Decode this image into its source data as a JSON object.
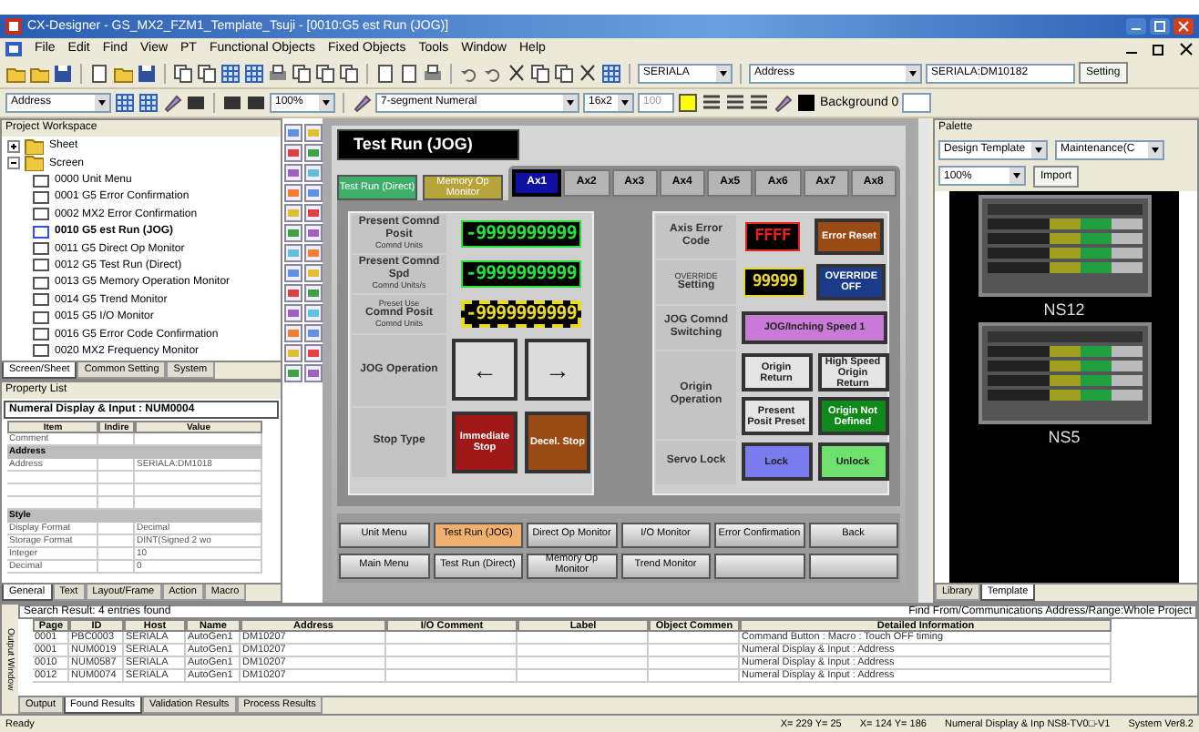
{
  "window": {
    "title": "CX-Designer - GS_MX2_FZM1_Template_Tsuji - [0010:G5 est Run (JOG)]"
  },
  "menu": [
    "File",
    "Edit",
    "Find",
    "View",
    "PT",
    "Functional Objects",
    "Fixed Objects",
    "Tools",
    "Window",
    "Help"
  ],
  "toolbar": {
    "host": "SERIALA",
    "address_mode": "Address",
    "address": "SERIALA:DM10182",
    "setting_button": "Setting"
  },
  "toolbar2": {
    "address_mode": "Address",
    "zoom": "100%",
    "object_type": "7-segment Numeral",
    "font_size": "16x2",
    "size": "100",
    "background": "Background 0"
  },
  "workspace": {
    "title": "Project Workspace",
    "tree": [
      {
        "label": "Sheet",
        "expanded": false
      },
      {
        "label": "Screen",
        "expanded": true,
        "children": [
          {
            "label": "0000 Unit Menu",
            "selected": false
          },
          {
            "label": "0001 G5 Error Confirmation",
            "selected": false
          },
          {
            "label": "0002 MX2 Error Confirmation",
            "selected": false
          },
          {
            "label": "0010 G5 est Run (JOG)",
            "selected": true
          },
          {
            "label": "0011 G5 Direct Op Monitor",
            "selected": false
          },
          {
            "label": "0012 G5 Test Run (Direct)",
            "selected": false
          },
          {
            "label": "0013 G5 Memory Operation Monitor",
            "selected": false
          },
          {
            "label": "0014 G5 Trend Monitor",
            "selected": false
          },
          {
            "label": "0015 G5 I/O Monitor",
            "selected": false
          },
          {
            "label": "0016 G5 Error Code Confirmation",
            "selected": false
          },
          {
            "label": "0020 MX2 Frequency Monitor",
            "selected": false
          }
        ]
      }
    ],
    "tabs": [
      {
        "label": "Screen/Sheet",
        "selected": true
      },
      {
        "label": "Common Setting",
        "selected": false
      },
      {
        "label": "System",
        "selected": false
      }
    ]
  },
  "property_list": {
    "title": "Property List",
    "object": "Numeral Display & Input : NUM0004",
    "columns": [
      "Item",
      "Indire",
      "Value"
    ],
    "rows": [
      {
        "kind": "row",
        "item": "Comment",
        "value": ""
      },
      {
        "kind": "section",
        "item": "Address",
        "value": ""
      },
      {
        "kind": "row",
        "item": "Address",
        "value": "SERIALA:DM1018"
      },
      {
        "kind": "row",
        "item": "",
        "value": ""
      },
      {
        "kind": "row",
        "item": "",
        "value": ""
      },
      {
        "kind": "row",
        "item": "",
        "value": ""
      },
      {
        "kind": "section",
        "item": "Style",
        "value": ""
      },
      {
        "kind": "row",
        "item": "Display Format",
        "value": "Decimal"
      },
      {
        "kind": "row",
        "item": "Storage Format",
        "value": "DINT(Signed 2 wo"
      },
      {
        "kind": "row",
        "item": "Integer",
        "value": "10"
      },
      {
        "kind": "row",
        "item": "Decimal",
        "value": "0"
      }
    ],
    "tabs": [
      {
        "label": "General",
        "selected": true
      },
      {
        "label": "Text",
        "selected": false
      },
      {
        "label": "Layout/Frame",
        "selected": false
      },
      {
        "label": "Action",
        "selected": false
      },
      {
        "label": "Macro",
        "selected": false
      }
    ]
  },
  "screen": {
    "title": "Test Run (JOG)",
    "top_buttons": [
      {
        "label": "Test Run (Direct)",
        "color": "#3fae6a"
      },
      {
        "label": "Memory Op Monitor",
        "color": "#b7a43a"
      }
    ],
    "axis_tabs": [
      {
        "label": "Ax1",
        "selected": true
      },
      {
        "label": "Ax2",
        "selected": false
      },
      {
        "label": "Ax3",
        "selected": false
      },
      {
        "label": "Ax4",
        "selected": false
      },
      {
        "label": "Ax5",
        "selected": false
      },
      {
        "label": "Ax6",
        "selected": false
      },
      {
        "label": "Ax7",
        "selected": false
      },
      {
        "label": "Ax8",
        "selected": false
      }
    ],
    "left_rows": [
      {
        "kind": "display",
        "note": "",
        "label": "Present Comnd Posit",
        "unit": "Comnd Units",
        "value": "-9999999999",
        "color": "#27e03a",
        "selected": false
      },
      {
        "kind": "display",
        "note": "",
        "label": "Present Comnd Spd",
        "unit": "Comnd Units/s",
        "value": "-9999999999",
        "color": "#27e03a",
        "selected": false
      },
      {
        "kind": "display",
        "note": "Preset Use",
        "label": "Comnd Posit",
        "unit": "Comnd Units",
        "value": "-9999999999",
        "color": "#e8d82a",
        "selected": true
      },
      {
        "kind": "arrows",
        "label": "JOG Operation",
        "buttons": [
          {
            "label": "←",
            "color": "#dcdcdc"
          },
          {
            "label": "→",
            "color": "#dcdcdc"
          }
        ]
      },
      {
        "kind": "buttons",
        "label": "Stop Type",
        "buttons": [
          {
            "label": "Immediate Stop",
            "color": "#a01818"
          },
          {
            "label": "Decel. Stop",
            "color": "#9a4a14"
          }
        ]
      }
    ],
    "right_rows": [
      {
        "kind": "display",
        "note": "",
        "label": "Axis Error Code",
        "value": "FFFF",
        "color": "#e8201c",
        "button": {
          "label": "Error Reset",
          "color": "#9a4a14"
        }
      },
      {
        "kind": "display",
        "note": "OVERRIDE",
        "label": "Setting",
        "value": "99999",
        "color": "#e8d82a",
        "button": {
          "label": "OVERRIDE OFF",
          "color": "#1a3a8a"
        }
      },
      {
        "kind": "buttons",
        "label": "JOG Comnd Switching",
        "buttons": [
          {
            "label": "JOG/Inching Speed 1",
            "color": "#c77ad6"
          }
        ]
      },
      {
        "kind": "buttons",
        "label": "Origin Operation",
        "buttons": [
          {
            "label": "Origin Return",
            "color": "#e4e4e4"
          },
          {
            "label": "High Speed Origin Return",
            "color": "#e4e4e4"
          },
          {
            "label": "Present Posit Preset",
            "color": "#e4e4e4"
          },
          {
            "label": "Origin Not Defined",
            "color": "#0f8a1a"
          }
        ]
      },
      {
        "kind": "buttons",
        "label": "Servo Lock",
        "buttons": [
          {
            "label": "Lock",
            "color": "#7b7bf0"
          },
          {
            "label": "Unlock",
            "color": "#6ee06e"
          }
        ]
      }
    ],
    "nav_buttons": [
      {
        "label": "Unit Menu",
        "selected": false
      },
      {
        "label": "Test Run (JOG)",
        "selected": true
      },
      {
        "label": "Direct Op Monitor",
        "selected": false
      },
      {
        "label": "I/O Monitor",
        "selected": false
      },
      {
        "label": "Error Confirmation",
        "selected": false
      },
      {
        "label": "Back",
        "selected": false
      },
      {
        "label": "Main Menu",
        "selected": false
      },
      {
        "label": "Test Run (Direct)",
        "selected": false
      },
      {
        "label": "Memory Op Monitor",
        "selected": false
      },
      {
        "label": "Trend Monitor",
        "selected": false
      },
      {
        "selected": false
      },
      {
        "selected": false
      }
    ]
  },
  "palette": {
    "title": "Palette",
    "template": "Design Template",
    "category": "Maintenance(C",
    "zoom": "100%",
    "import_button": "Import",
    "previews": [
      "NS12",
      "NS5"
    ],
    "tabs": [
      {
        "label": "Library",
        "selected": false
      },
      {
        "label": "Template",
        "selected": true
      }
    ]
  },
  "output": {
    "title": "Output Window",
    "summary": "Search Result: 4 entries found",
    "scope": "Find From/Communications Address/Range:Whole Project",
    "columns": [
      "Page",
      "ID",
      "Host",
      "Name",
      "Address",
      "I/O Comment",
      "Label",
      "Object Commen",
      "Detailed Information"
    ],
    "rows": [
      [
        "0001",
        "PBC0003",
        "SERIALA",
        "AutoGen1",
        "DM10207",
        "",
        "",
        "",
        "Command Button : Macro : Touch OFF timing"
      ],
      [
        "0001",
        "NUM0019",
        "SERIALA",
        "AutoGen1",
        "DM10207",
        "",
        "",
        "",
        "Numeral Display & Input : Address"
      ],
      [
        "0010",
        "NUM0587",
        "SERIALA",
        "AutoGen1",
        "DM10207",
        "",
        "",
        "",
        "Numeral Display & Input : Address"
      ],
      [
        "0012",
        "NUM0074",
        "SERIALA",
        "AutoGen1",
        "DM10207",
        "",
        "",
        "",
        "Numeral Display & Input : Address"
      ]
    ],
    "tabs": [
      {
        "label": "Output",
        "selected": false
      },
      {
        "label": "Found Results",
        "selected": true
      },
      {
        "label": "Validation Results",
        "selected": false
      },
      {
        "label": "Process Results",
        "selected": false
      }
    ]
  },
  "status_bar": [
    "Ready",
    "X= 229 Y= 25",
    "X= 124 Y= 186",
    "Numeral Display & Inp NS8-TV0□-V1",
    "System Ver8.2"
  ]
}
